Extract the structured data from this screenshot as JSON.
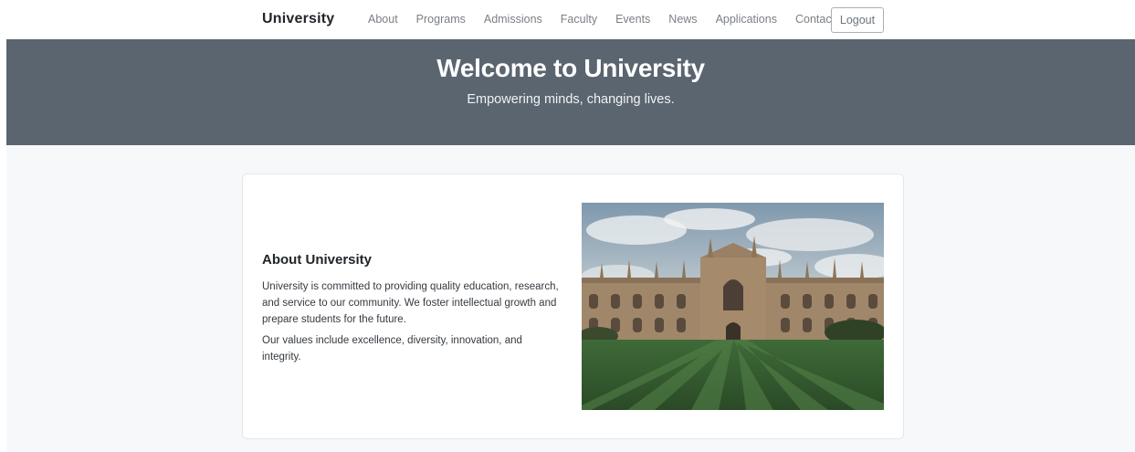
{
  "navbar": {
    "brand": "University",
    "links": [
      "About",
      "Programs",
      "Admissions",
      "Faculty",
      "Events",
      "News",
      "Applications",
      "Contact"
    ],
    "logout_label": "Logout"
  },
  "hero": {
    "title": "Welcome to University",
    "subtitle": "Empowering minds, changing lives."
  },
  "about": {
    "title": "About University",
    "paragraph1": "University is committed to providing quality education, research, and service to our community. We foster intellectual growth and prepare students for the future.",
    "paragraph2": "Our values include excellence, diversity, innovation, and integrity.",
    "image_alt": "campus-building-photo"
  },
  "colors": {
    "hero_bg": "#5a6570",
    "content_bg": "#f7f8f9",
    "nav_link": "#7a7f85"
  }
}
